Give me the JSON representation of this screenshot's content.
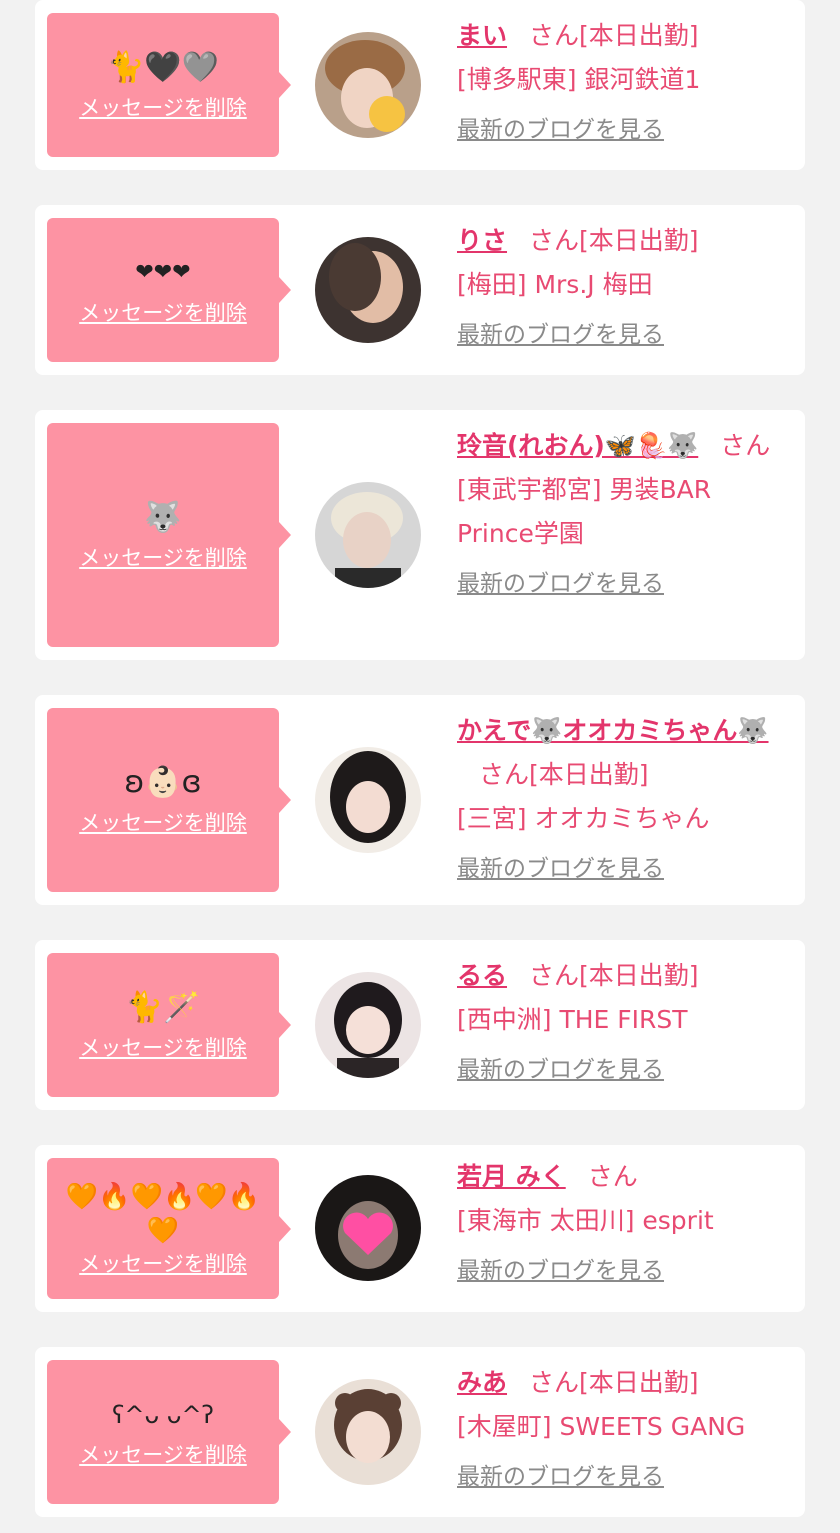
{
  "delete_label": "メッセージを削除",
  "blog_label": "最新のブログを見る",
  "honorific": "さん",
  "colors": {
    "bubble": "#fd93a3",
    "accent": "#e3356b",
    "background": "#f2f2f2"
  },
  "entries": [
    {
      "message": "🐈🖤🩶",
      "name": "まい",
      "status": "[本日出勤]",
      "shop": "[博多駅東] 銀河鉄道1"
    },
    {
      "message": "❤︎❤︎❤︎",
      "name": "りさ",
      "status": "[本日出勤]",
      "shop": "[梅田] Mrs.J 梅田"
    },
    {
      "message": "🐺",
      "name": "玲音(れおん)🦋🪼🐺",
      "status": "",
      "shop": "[東武宇都宮] 男装BAR Prince学園"
    },
    {
      "message": "ʚ👶🏻ɞ",
      "name": "かえで🐺オオカミちゃん🐺",
      "status": "[本日出勤]",
      "shop": "[三宮] オオカミちゃん"
    },
    {
      "message": "🐈🪄",
      "name": "るる",
      "status": "[本日出勤]",
      "shop": "[西中洲] THE FIRST"
    },
    {
      "message": "🧡🔥🧡🔥🧡🔥🧡",
      "name": "若月 みく",
      "status": "",
      "shop": "[東海市 太田川] esprit"
    },
    {
      "message": "ʕ^ᴗ ᴗ^ʔ",
      "name": "みあ",
      "status": "[本日出勤]",
      "shop": "[木屋町] SWEETS GANG"
    }
  ]
}
